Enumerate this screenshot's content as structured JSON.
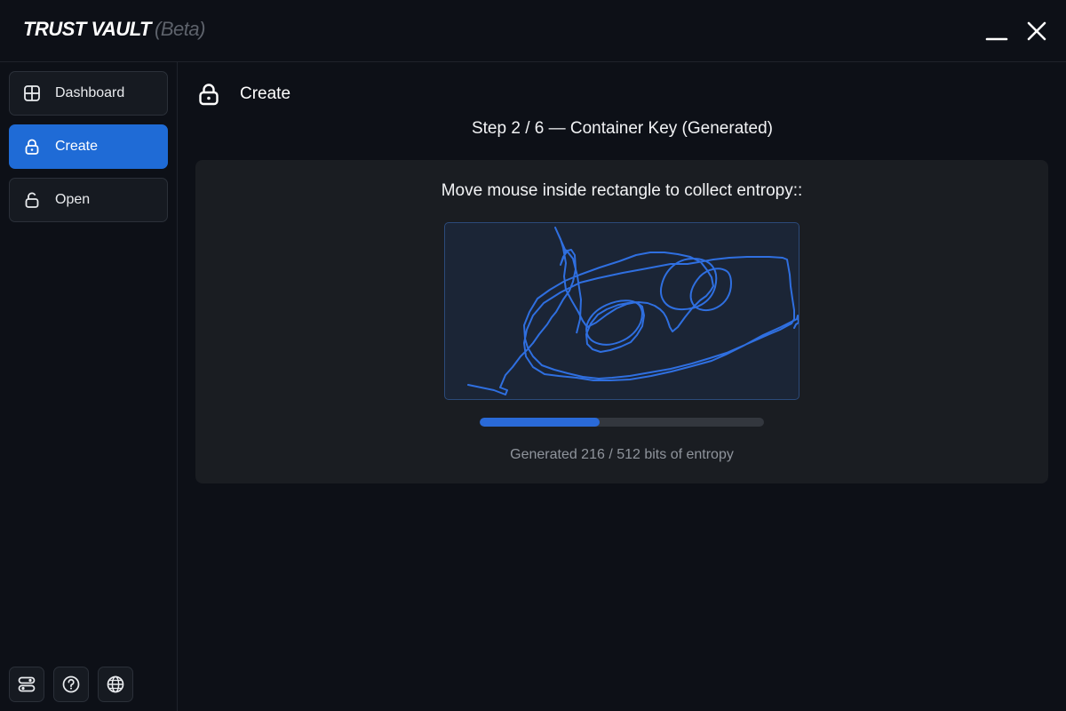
{
  "app": {
    "title": "TRUST VAULT",
    "badge": "(Beta)"
  },
  "window_controls": {
    "minimize_icon": "minimize-icon",
    "close_icon": "close-icon"
  },
  "sidebar": {
    "items": [
      {
        "label": "Dashboard",
        "icon": "grid-icon",
        "active": false
      },
      {
        "label": "Create",
        "icon": "lock-icon",
        "active": true
      },
      {
        "label": "Open",
        "icon": "unlock-icon",
        "active": false
      }
    ],
    "footer_buttons": [
      {
        "icon": "settings-sliders-icon"
      },
      {
        "icon": "help-icon"
      },
      {
        "icon": "globe-icon"
      }
    ]
  },
  "main": {
    "header_title": "Create",
    "step_title": "Step 2 / 6 — Container Key (Generated)",
    "instruction": "Move mouse inside rectangle to collect entropy::",
    "entropy": {
      "generated": 216,
      "total": 512,
      "progress_fraction": 0.422,
      "status_text": "Generated 216 / 512 bits of entropy"
    }
  },
  "colors": {
    "background": "#0d1017",
    "accent": "#1f6bd6",
    "card": "#1a1d22",
    "entropy_area": "#1b2536",
    "trace": "#2f6fe0"
  }
}
